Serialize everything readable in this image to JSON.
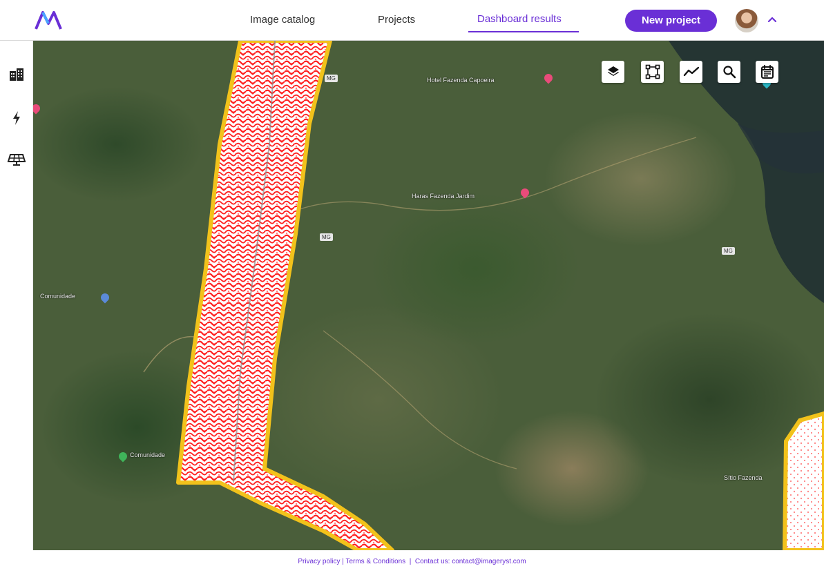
{
  "header": {
    "logo_icon": "imageryst-logo-icon",
    "nav": {
      "image_catalog": "Image catalog",
      "projects": "Projects",
      "dashboard_results": "Dashboard results"
    },
    "new_project_label": "New project",
    "accent_color": "#6a2fd6"
  },
  "sidebar": {
    "items": [
      {
        "icon": "buildings-icon"
      },
      {
        "icon": "lightning-icon"
      },
      {
        "icon": "solar-panel-icon"
      }
    ]
  },
  "map": {
    "toolbar": [
      {
        "icon": "layers-icon"
      },
      {
        "icon": "polygon-draw-icon"
      },
      {
        "icon": "line-chart-icon"
      },
      {
        "icon": "search-icon"
      },
      {
        "icon": "calendar-icon"
      }
    ],
    "overlay_colors": {
      "border": "#f2c21b",
      "heat": "#ff1f1f",
      "base": "#ffffff"
    }
  },
  "footer": {
    "privacy": "Privacy policy",
    "terms": "Terms & Conditions",
    "contact_prefix": "Contact us:",
    "contact_email": "contact@imageryst.com"
  }
}
